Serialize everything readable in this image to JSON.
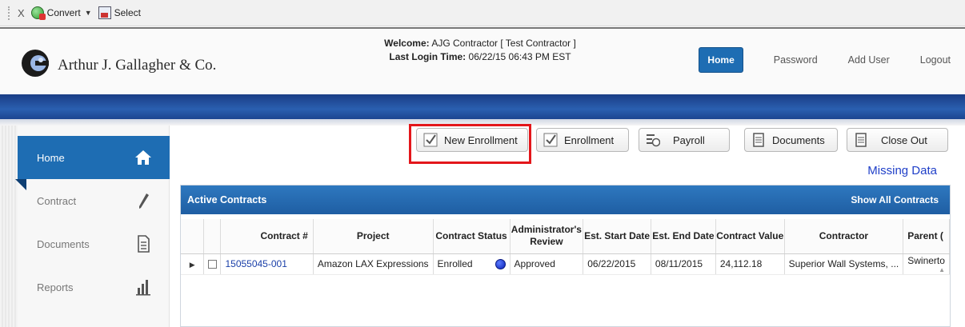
{
  "toolbar": {
    "close_label": "X",
    "convert_label": "Convert",
    "select_label": "Select"
  },
  "header": {
    "company_name": "Arthur J. Gallagher & Co.",
    "welcome_label": "Welcome:",
    "welcome_value": "AJG Contractor [ Test Contractor ]",
    "last_login_label": "Last Login Time:",
    "last_login_value": "06/22/15 06:43 PM EST",
    "nav": {
      "home": "Home",
      "password": "Password",
      "add_user": "Add User",
      "logout": "Logout"
    }
  },
  "sidebar": {
    "items": [
      {
        "label": "Home",
        "icon": "house-icon",
        "active": true
      },
      {
        "label": "Contract",
        "icon": "pencil-icon",
        "active": false
      },
      {
        "label": "Documents",
        "icon": "document-icon",
        "active": false
      },
      {
        "label": "Reports",
        "icon": "bar-chart-icon",
        "active": false
      }
    ]
  },
  "actions": {
    "new_enrollment": "New Enrollment",
    "enrollment": "Enrollment",
    "payroll": "Payroll",
    "documents": "Documents",
    "close_out": "Close Out",
    "missing_data": "Missing Data"
  },
  "panel": {
    "title": "Active Contracts",
    "show_all": "Show All Contracts",
    "columns": [
      "Contract #",
      "Project",
      "Contract Status",
      "Administrator's Review",
      "Est. Start Date",
      "Est. End Date",
      "Contract Value",
      "Contractor",
      "Parent ("
    ],
    "rows": [
      {
        "contract": "15055045-001",
        "project": "Amazon LAX Expressions",
        "status": "Enrolled",
        "review": "Approved",
        "start": "06/22/2015",
        "end": "08/11/2015",
        "value": "24,112.18",
        "contractor": "Superior Wall Systems, ...",
        "parent": "Swinerto"
      }
    ]
  },
  "colors": {
    "primary_blue": "#1e6db3",
    "band_blue": "#1a3d86",
    "highlight_red": "#e3161b",
    "link_blue": "#1f3fc8",
    "status_dot": "#0a1fb5"
  }
}
